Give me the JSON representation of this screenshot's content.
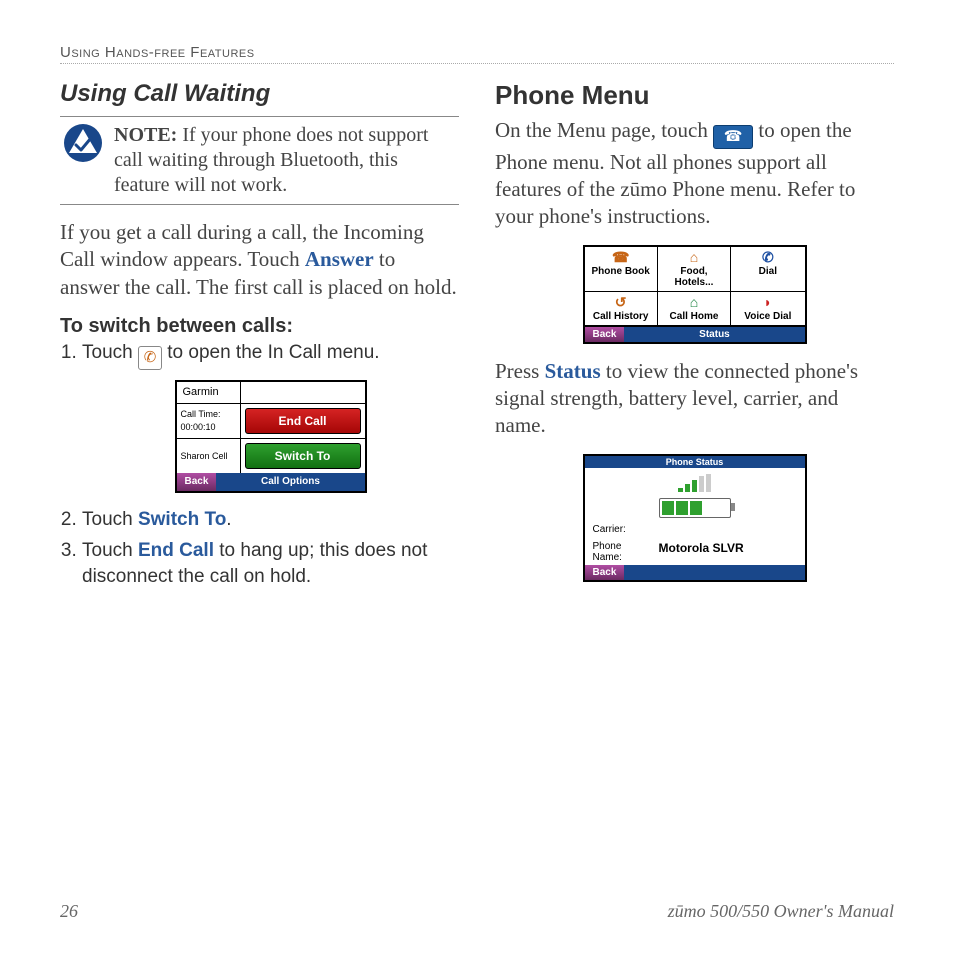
{
  "header": {
    "running_title": "Using Hands-free Features"
  },
  "col1": {
    "heading": "Using Call Waiting",
    "note": {
      "label": "NOTE:",
      "text": "If your phone does not support call waiting through Bluetooth, this feature will not work."
    },
    "para1_pre": "If you get a call during a call, the Incoming Call window appears. Touch ",
    "para1_kw": "Answer",
    "para1_post": " to answer the call. The first call is placed on hold.",
    "sub_heading": "To switch between calls:",
    "step1_pre": "Touch ",
    "step1_post": " to open the In Call menu.",
    "screenshot1": {
      "brand": "Garmin",
      "call_time_label": "Call Time:",
      "call_time_value": "00:00:10",
      "contact_name": "Sharon Cell",
      "end_call": "End Call",
      "switch_to": "Switch To",
      "back": "Back",
      "footer_center": "Call Options"
    },
    "step2_pre": "Touch ",
    "step2_kw": "Switch To",
    "step2_post": ".",
    "step3_pre": "Touch ",
    "step3_kw": "End Call",
    "step3_post": " to hang up; this does not disconnect the call on hold."
  },
  "col2": {
    "heading": "Phone Menu",
    "para1_pre": "On the Menu page, touch ",
    "para1_post": " to open the Phone menu. Not all phones support all features of the zūmo Phone menu. Refer to your phone's instructions.",
    "screenshot2": {
      "cells": [
        "Phone Book",
        "Food, Hotels...",
        "Dial",
        "Call History",
        "Call Home",
        "Voice Dial"
      ],
      "back": "Back",
      "footer_center": "Status"
    },
    "para2_pre": "Press ",
    "para2_kw": "Status",
    "para2_post": " to view the connected phone's signal strength, battery level, carrier, and name.",
    "screenshot3": {
      "title": "Phone Status",
      "carrier_label": "Carrier:",
      "carrier_value": "",
      "phone_name_label": "Phone Name:",
      "phone_name_value": "Motorola SLVR",
      "back": "Back"
    }
  },
  "footer": {
    "page_number": "26",
    "manual_title": "zūmo 500/550 Owner's Manual"
  },
  "icons": {
    "in_call": "✆",
    "phone_bubble": "☎"
  }
}
